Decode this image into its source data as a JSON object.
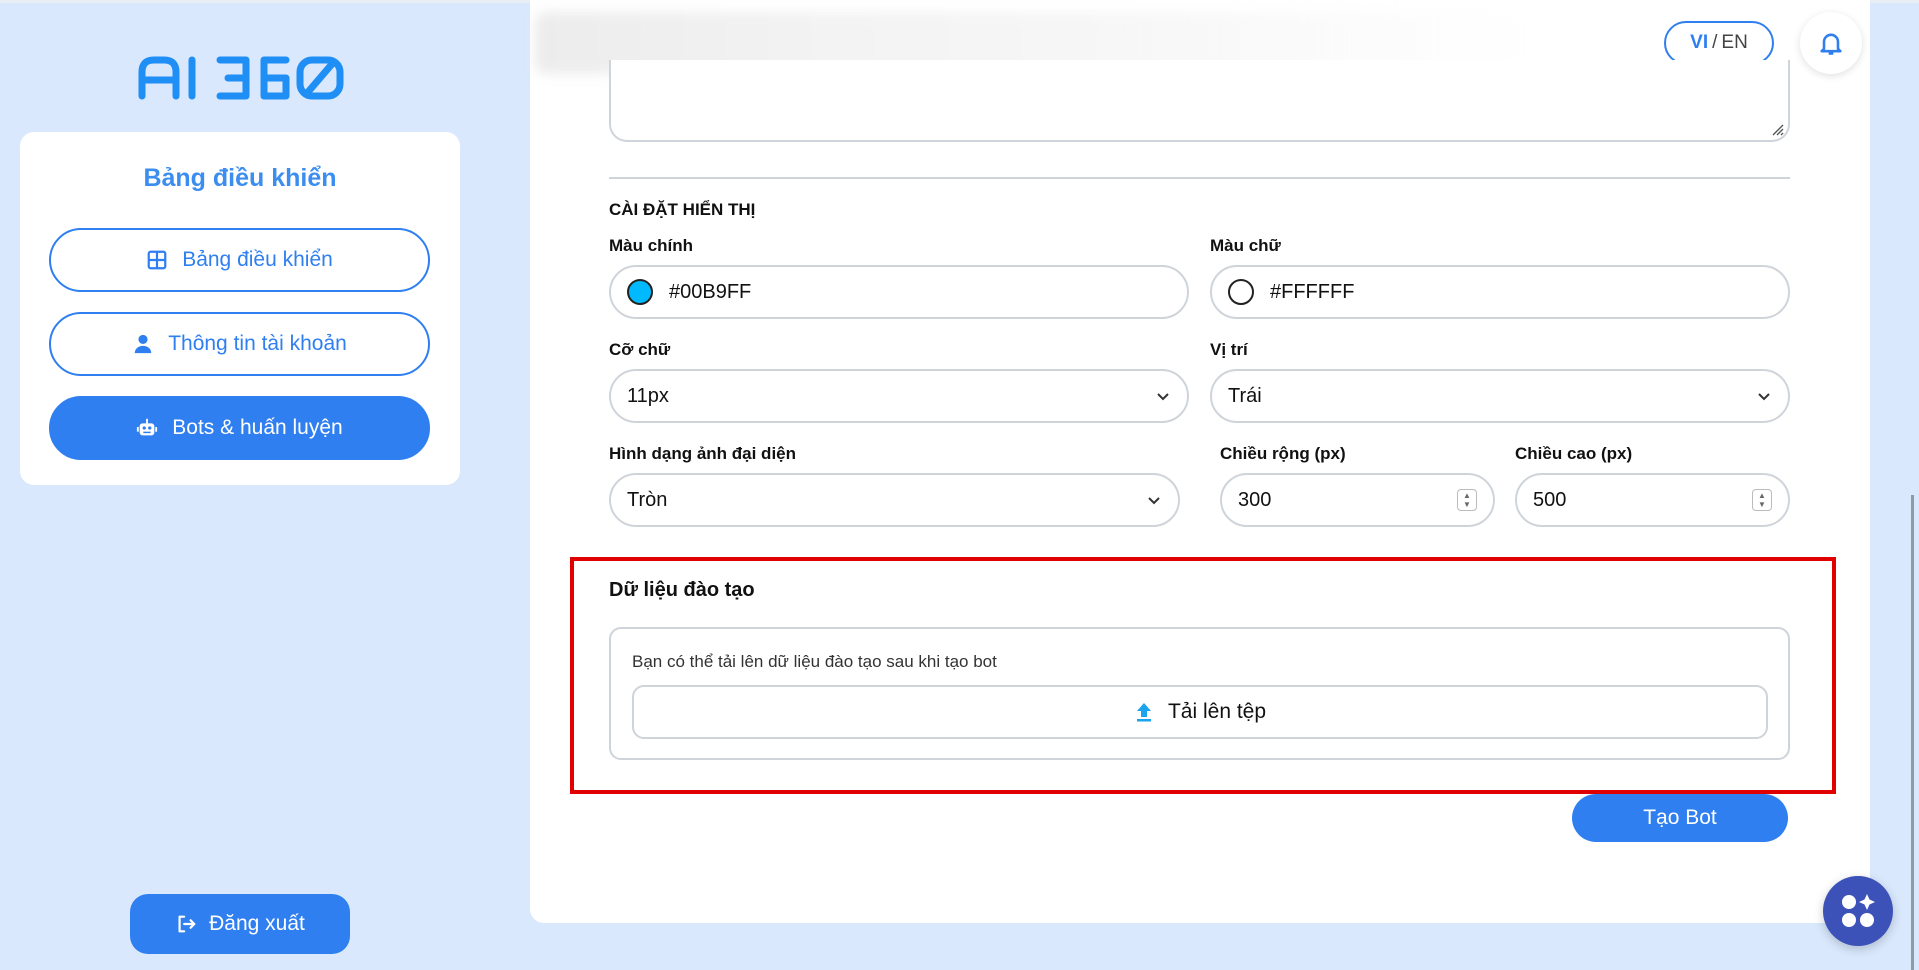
{
  "logo": {
    "text": "AI 360"
  },
  "sidebar": {
    "title": "Bảng điều khiển",
    "items": [
      {
        "label": "Bảng điều khiển",
        "icon": "grid-icon",
        "active": false
      },
      {
        "label": "Thông tin tài khoản",
        "icon": "user-icon",
        "active": false
      },
      {
        "label": "Bots & huấn luyện",
        "icon": "robot-icon",
        "active": true
      }
    ],
    "logout_label": "Đăng xuất"
  },
  "header": {
    "lang_vi": "VI",
    "lang_sep": "/",
    "lang_en": "EN",
    "bell_icon": "bell-icon"
  },
  "display_settings": {
    "section_title": "CÀI ĐẶT HIỂN THỊ",
    "primary_color": {
      "label": "Màu chính",
      "value": "#00B9FF",
      "swatch": "#00B9FF"
    },
    "text_color": {
      "label": "Màu chữ",
      "value": "#FFFFFF",
      "swatch": "#FFFFFF"
    },
    "font_size": {
      "label": "Cỡ chữ",
      "value": "11px"
    },
    "position": {
      "label": "Vị trí",
      "value": "Trái"
    },
    "avatar_shape": {
      "label": "Hình dạng ảnh đại diện",
      "value": "Tròn"
    },
    "width": {
      "label": "Chiều rộng (px)",
      "value": "300"
    },
    "height": {
      "label": "Chiều cao (px)",
      "value": "500"
    }
  },
  "training": {
    "title": "Dữ liệu đào tạo",
    "hint": "Bạn có thể tải lên dữ liệu đào tạo sau khi tạo bot",
    "upload_label": "Tải lên tệp",
    "upload_icon": "upload-icon"
  },
  "create_button": "Tạo Bot",
  "colors": {
    "accent": "#2F7FF0",
    "background": "#D9E8FD",
    "highlight": "#E00000"
  }
}
